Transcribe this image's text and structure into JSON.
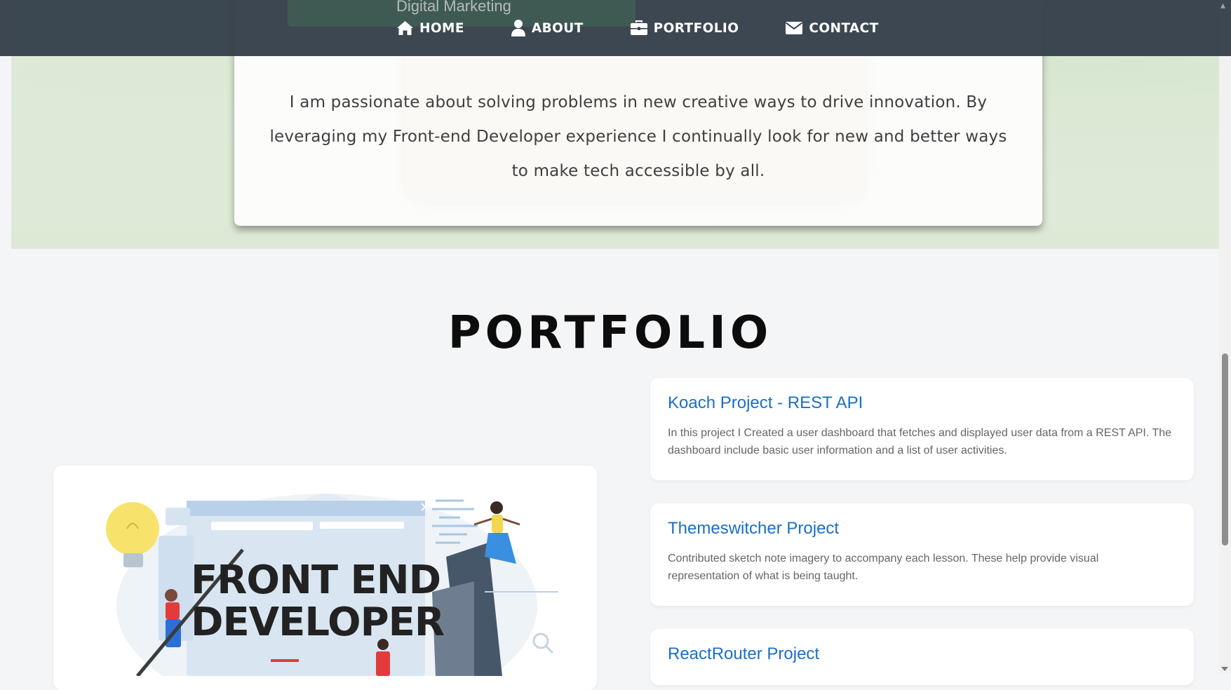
{
  "nav": {
    "behind_label": "Digital Marketing",
    "items": [
      {
        "label": "HOME",
        "icon": "home-icon"
      },
      {
        "label": "ABOUT",
        "icon": "user-icon"
      },
      {
        "label": "PORTFOLIO",
        "icon": "briefcase-icon"
      },
      {
        "label": "CONTACT",
        "icon": "envelope-icon"
      }
    ]
  },
  "about": {
    "text": "I am passionate about solving problems in new creative ways to drive innovation. By leveraging my Front-end Developer experience I continually look for new and better ways to make tech accessible by all."
  },
  "portfolio": {
    "title": "PORTFOLIO",
    "image": {
      "heading_line1": "FRONT END",
      "heading_line2": "DEVELOPER"
    },
    "projects": [
      {
        "title": "Koach Project - REST API",
        "description": "In this project I Created a user dashboard that fetches and displayed user data from a REST API. The dashboard include basic user information and a list of user activities."
      },
      {
        "title": "Themeswitcher Project",
        "description": "Contributed sketch note imagery to accompany each lesson. These help provide visual representation of what is being taught."
      },
      {
        "title": "ReactRouter Project",
        "description": ""
      }
    ]
  },
  "colors": {
    "nav_bg": "#343f4b",
    "link_blue": "#1a6fc9",
    "about_band": "#dde9d6"
  }
}
